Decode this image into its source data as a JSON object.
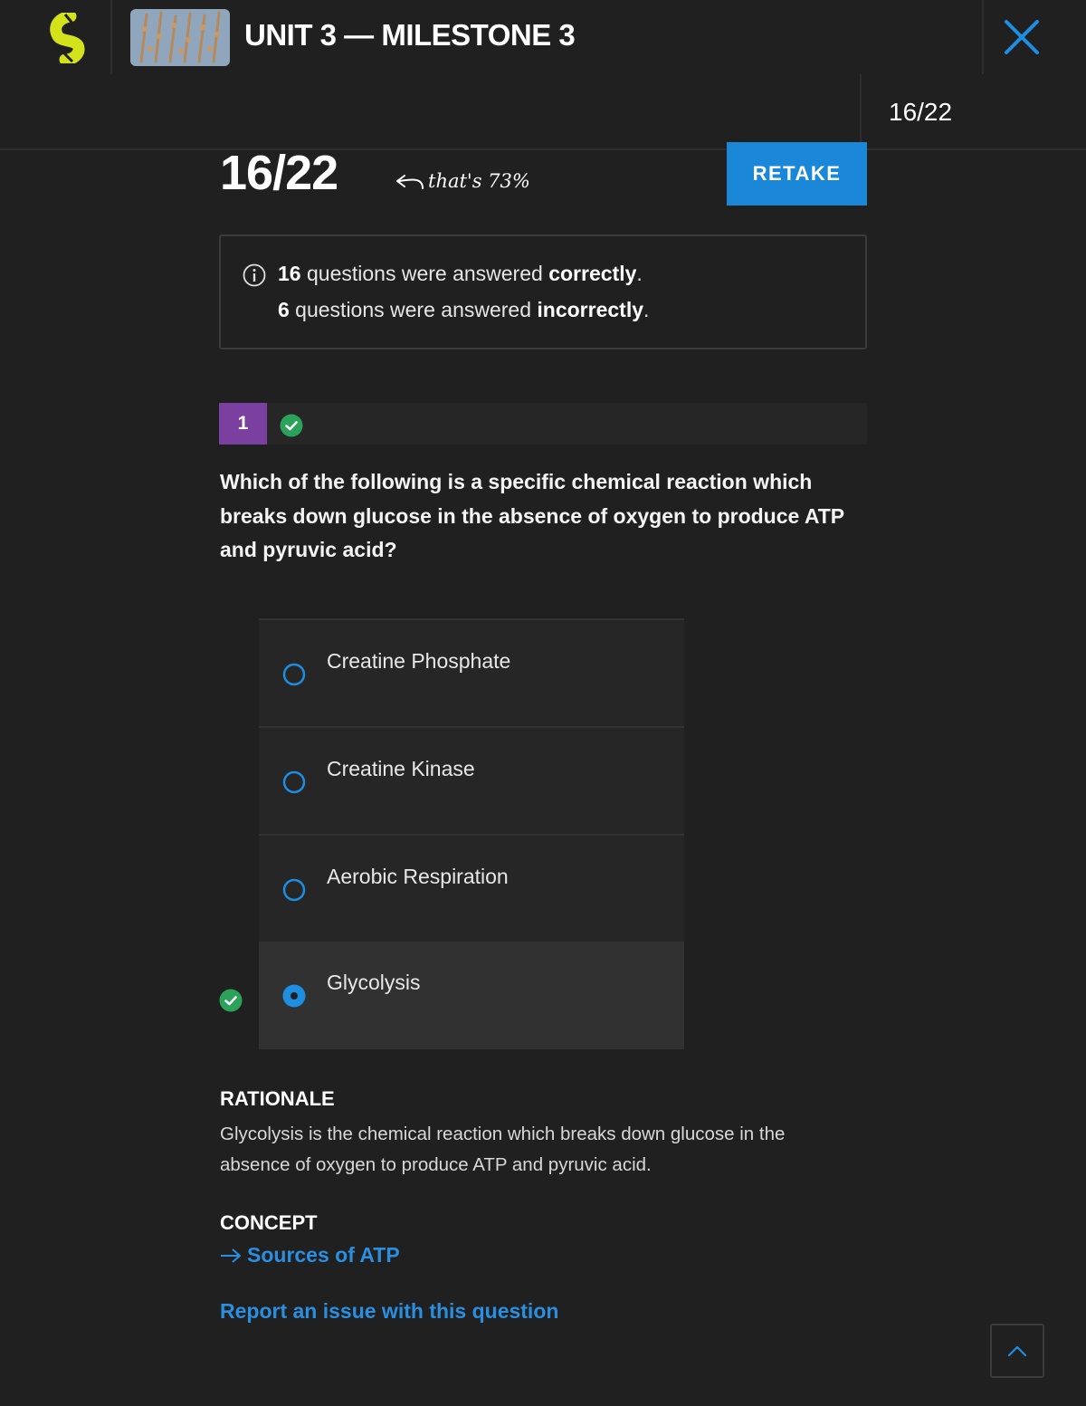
{
  "header": {
    "title": "UNIT 3 — MILESTONE 3",
    "progress": "16/22"
  },
  "result": {
    "score": "16/22",
    "percent_note": "that's 73%",
    "retake_label": "RETAKE"
  },
  "summary": {
    "correct_count": "16",
    "correct_text": " questions were answered ",
    "correct_word": "correctly",
    "incorrect_count": "6",
    "incorrect_text": " questions were answered ",
    "incorrect_word": "incorrectly",
    "period": "."
  },
  "question": {
    "number": "1",
    "status": "correct",
    "text": "Which of the following is a specific chemical reaction which breaks down glucose in the absence of oxygen to produce ATP and pyruvic acid?",
    "options": [
      {
        "label": "Creatine Phosphate",
        "selected": false
      },
      {
        "label": "Creatine Kinase",
        "selected": false
      },
      {
        "label": "Aerobic Respiration",
        "selected": false
      },
      {
        "label": "Glycolysis",
        "selected": true
      }
    ]
  },
  "rationale": {
    "title": "RATIONALE",
    "text": "Glycolysis is the chemical reaction which breaks down glucose in the absence of oxygen to produce ATP and pyruvic acid."
  },
  "concept": {
    "title": "CONCEPT",
    "link": "Sources of ATP"
  },
  "report_link": "Report an issue with this question",
  "colors": {
    "background": "#202021",
    "accent_blue": "#1a87d9",
    "question_badge": "#7b3fa0",
    "correct_green": "#2aa25a",
    "logo_yellow": "#d4e21b"
  },
  "icons": {
    "logo": "sophia-logo",
    "close": "close-icon",
    "info": "info-icon",
    "check": "check-circle-icon",
    "arrow": "arrow-right-icon",
    "scroll": "chevron-up-icon"
  }
}
